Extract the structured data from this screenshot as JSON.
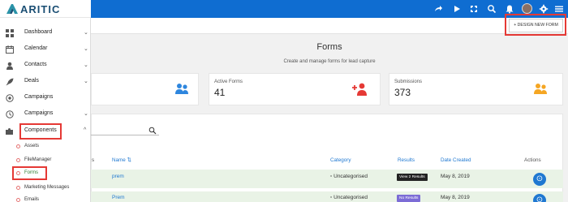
{
  "app": {
    "logo_text": "ARITIC"
  },
  "topbar": {
    "icons": [
      "share-icon",
      "play-icon",
      "fullscreen-icon",
      "search-icon",
      "bell-icon",
      "avatar",
      "gear-icon",
      "menu-icon"
    ]
  },
  "sidebar": {
    "items": [
      {
        "label": "Dashboard",
        "icon": "grid-icon",
        "chevron": "⌄"
      },
      {
        "label": "Calendar",
        "icon": "calendar-icon",
        "chevron": "⌄"
      },
      {
        "label": "Contacts",
        "icon": "person-icon",
        "chevron": "⌄"
      },
      {
        "label": "Deals",
        "icon": "rocket-icon",
        "chevron": "⌄"
      },
      {
        "label": "Campaigns",
        "icon": "target-icon",
        "chevron": ""
      },
      {
        "label": "Campaigns",
        "icon": "clock-icon",
        "chevron": "⌄"
      },
      {
        "label": "Components",
        "icon": "puzzle-icon",
        "chevron": "^"
      }
    ],
    "sub_items": [
      {
        "label": "Assets"
      },
      {
        "label": "FileManager"
      },
      {
        "label": "Forms"
      },
      {
        "label": "Marketing Messages"
      },
      {
        "label": "Emails"
      }
    ]
  },
  "header": {
    "design_button": "+ DESIGN NEW FORM"
  },
  "page": {
    "title": "Forms",
    "subtitle": "Create and manage forms for lead capture"
  },
  "cards": [
    {
      "label": "",
      "value": ""
    },
    {
      "label": "Active Forms",
      "value": "41"
    },
    {
      "label": "Submissions",
      "value": "373"
    }
  ],
  "table": {
    "columns": {
      "s": "s",
      "name": "Name",
      "category": "Category",
      "results": "Results",
      "date_created": "Date Created",
      "actions": "Actions"
    },
    "rows": [
      {
        "name": "prem",
        "category": "Uncategorised",
        "results": "View 2 Results",
        "date": "May 8, 2019"
      },
      {
        "name": "Prem",
        "category": "Uncategorised",
        "results": "No Results",
        "date": "May 8, 2019"
      }
    ]
  },
  "colors": {
    "topbar": "#0f6dd1",
    "accent_blue": "#1f78d1",
    "highlight_red": "#e53935",
    "row_green": "#e9f3e6"
  }
}
